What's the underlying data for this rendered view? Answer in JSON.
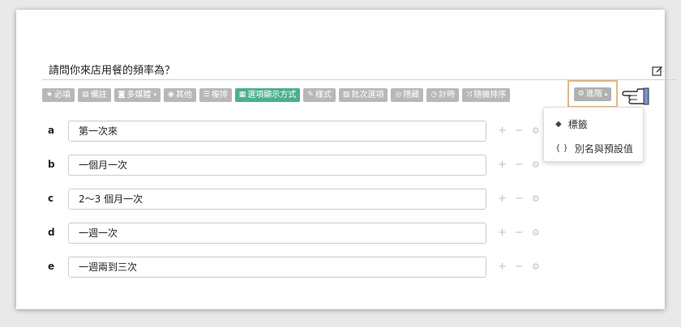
{
  "question": {
    "title": "請問你來店用餐的頻率為？"
  },
  "toolbar": {
    "buttons": [
      {
        "icon": "★",
        "label": "必填"
      },
      {
        "icon": "▤",
        "label": "備註"
      },
      {
        "icon": "◙",
        "label": "多媒體",
        "caret": "▾"
      },
      {
        "icon": "◉",
        "label": "其他"
      },
      {
        "icon": "☰",
        "label": "複排"
      },
      {
        "icon": "▦",
        "label": "選項顯示方式"
      },
      {
        "icon": "✎",
        "label": "樣式"
      },
      {
        "icon": "▧",
        "label": "批次選項"
      },
      {
        "icon": "◎",
        "label": "隱藏"
      },
      {
        "icon": "◷",
        "label": "計時"
      },
      {
        "icon": "⤨",
        "label": "隨機排序"
      }
    ],
    "advanced": {
      "icon": "⚙",
      "label": "進階",
      "caret": "▴"
    }
  },
  "dropdown": {
    "items": [
      {
        "icon": "◆",
        "label": "標籤"
      },
      {
        "icon": "{ }",
        "label": "別名與預設值"
      }
    ]
  },
  "options": [
    {
      "letter": "a",
      "value": "第一次來"
    },
    {
      "letter": "b",
      "value": "一個月一次"
    },
    {
      "letter": "c",
      "value": "2～3 個月一次"
    },
    {
      "letter": "d",
      "value": "一週一次"
    },
    {
      "letter": "e",
      "value": "一週兩到三次"
    }
  ],
  "option_actions": {
    "add": "+",
    "remove": "−",
    "settings": "⚙"
  },
  "colors": {
    "active_button": "#4caf8e",
    "button": "#b8b8b8",
    "highlight_border": "#e0b887"
  }
}
